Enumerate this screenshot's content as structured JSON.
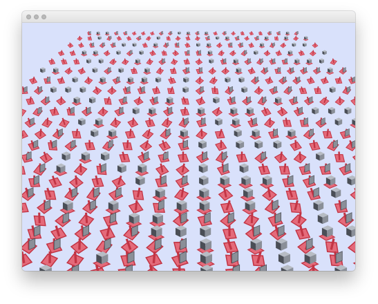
{
  "window": {
    "title": "",
    "controls": [
      "close-button",
      "minimize-button",
      "zoom-button"
    ]
  },
  "scene": {
    "background_color": "#d9e1fb",
    "panel_color": "#c23444",
    "panel_fill_color": "#e46a7a",
    "cube_color": "#8a8f98",
    "cube_dark_color": "#4a4e56",
    "grid_rows": 24,
    "grid_cols": 24
  }
}
